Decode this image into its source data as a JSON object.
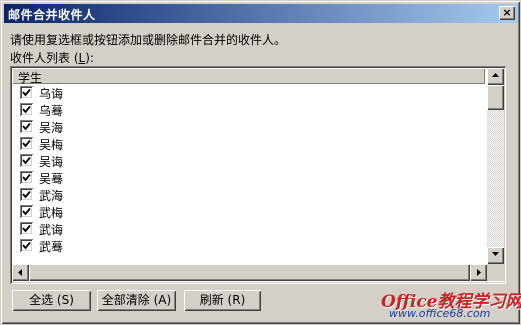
{
  "dialog": {
    "title": "邮件合并收件人",
    "close_glyph": "×",
    "instruction": "请使用复选框或按钮添加或删除邮件合并的收件人。",
    "list_label_prefix": "收件人列表 (",
    "list_label_key": "L",
    "list_label_suffix": "):"
  },
  "list": {
    "column_header": "学生",
    "rows": [
      {
        "name": "乌诲",
        "checked": true
      },
      {
        "name": "乌蓦",
        "checked": true
      },
      {
        "name": "吴海",
        "checked": true
      },
      {
        "name": "吴梅",
        "checked": true
      },
      {
        "name": "吴诲",
        "checked": true
      },
      {
        "name": "吴蓦",
        "checked": true
      },
      {
        "name": "武海",
        "checked": true
      },
      {
        "name": "武梅",
        "checked": true
      },
      {
        "name": "武诲",
        "checked": true
      },
      {
        "name": "武蓦",
        "checked": true
      }
    ]
  },
  "buttons": {
    "select_all": "全选 (S)",
    "clear_all": "全部清除 (A)",
    "refresh": "刷新 (R)"
  },
  "watermark": {
    "main": "Office教程学习网",
    "sub": "www.office68.com"
  },
  "colors": {
    "titlebar_start": "#0a246a",
    "titlebar_end": "#a6caf0",
    "face": "#d4d0c8",
    "watermark_red": "#d22020",
    "watermark_blue": "#1b3fa0"
  }
}
